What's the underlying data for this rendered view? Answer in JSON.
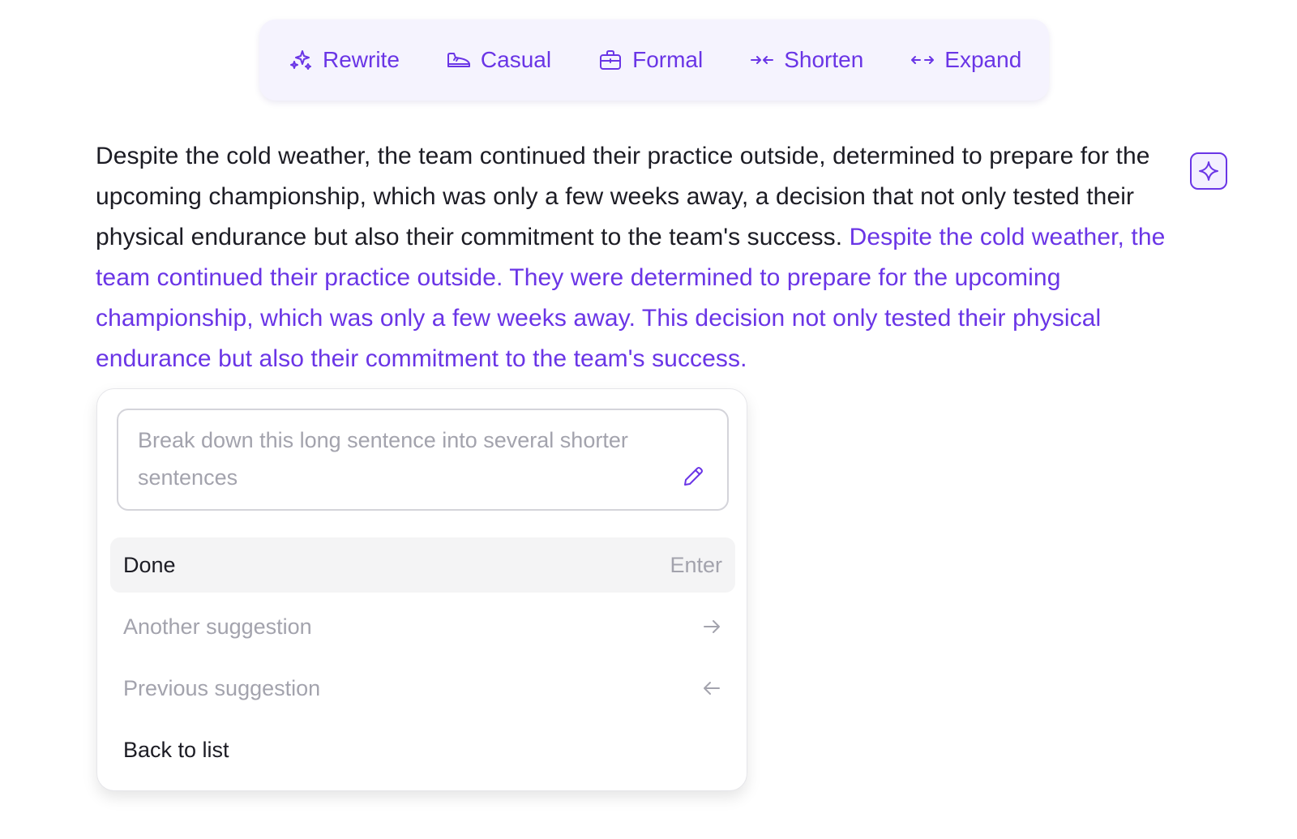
{
  "toolbar": {
    "items": [
      {
        "label": "Rewrite",
        "icon": "sparkles-icon"
      },
      {
        "label": "Casual",
        "icon": "sneaker-icon"
      },
      {
        "label": "Formal",
        "icon": "briefcase-icon"
      },
      {
        "label": "Shorten",
        "icon": "arrows-inward-icon"
      },
      {
        "label": "Expand",
        "icon": "arrows-outward-icon"
      }
    ]
  },
  "editor": {
    "original_text": "Despite the cold weather, the team continued their practice outside, determined to prepare for the upcoming championship, which was only a few weeks away, a decision that not only tested their physical endurance but also their commitment to the team's success. ",
    "suggested_text": "Despite the cold weather, the team continued their practice outside. They were determined to prepare for the upcoming championship, which was only a few weeks away. This decision not only tested their physical endurance but also their commitment to the team's success."
  },
  "popup": {
    "prompt_text": "Break down this long sentence into several shorter sentences",
    "done_label": "Done",
    "done_shortcut": "Enter",
    "another_label": "Another suggestion",
    "previous_label": "Previous suggestion",
    "back_label": "Back to list"
  },
  "colors": {
    "accent": "#6a35e6",
    "toolbar_bg": "#f5f3fe",
    "muted_text": "#a3a3ad",
    "body_text": "#1c1c24"
  }
}
